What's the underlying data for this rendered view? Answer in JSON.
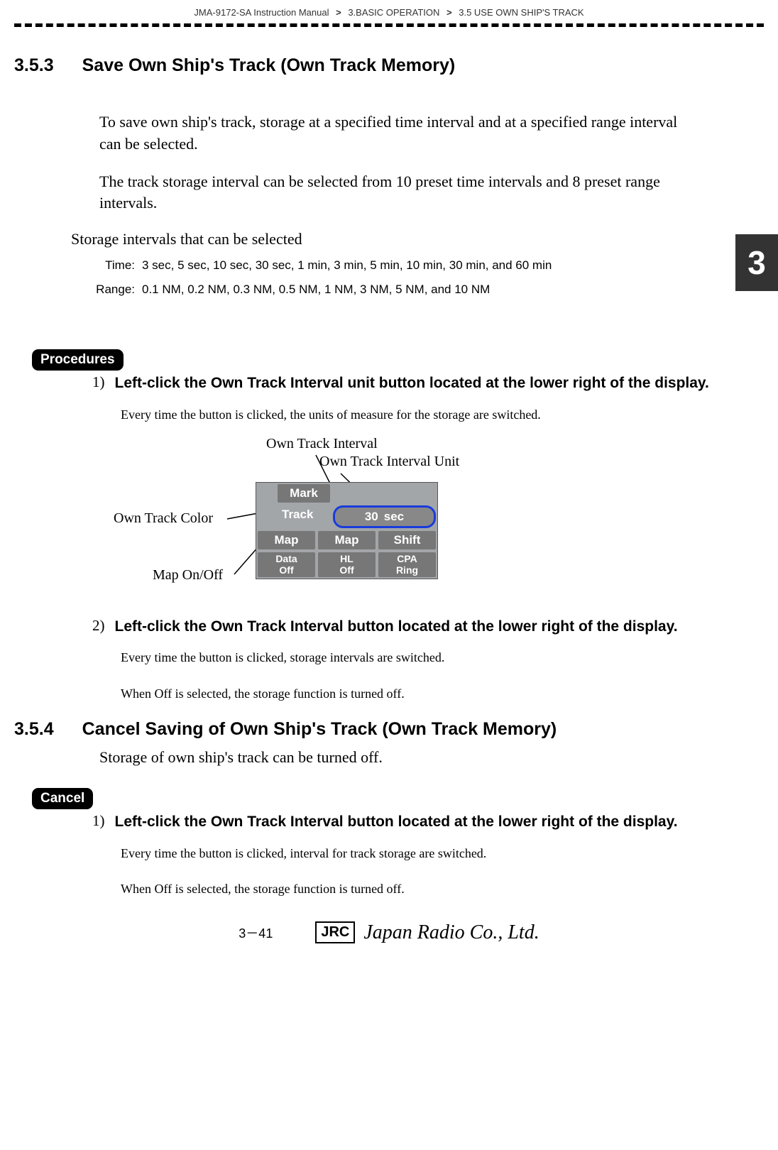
{
  "breadcrumb": {
    "manual": "JMA-9172-SA Instruction Manual",
    "chapter": "3.BASIC OPERATION",
    "section": "3.5  USE OWN SHIP'S TRACK",
    "sep": ">"
  },
  "chapter_tab": "3",
  "sec353": {
    "num": "3.5.3",
    "title": "Save Own Ship's Track (Own Track Memory)",
    "p1": "To save own ship's track, storage at a specified time interval and at a specified range interval can be selected.",
    "p2": "The track storage interval can be selected from 10 preset time intervals and 8 preset range intervals.",
    "subhead": "Storage intervals that can be selected",
    "time_label": "Time:",
    "time_values": "3 sec, 5 sec, 10 sec, 30 sec, 1 min, 3 min, 5 min, 10 min, 30 min, and 60 min",
    "range_label": "Range:",
    "range_values": "0.1 NM, 0.2 NM, 0.3 NM, 0.5 NM, 1 NM, 3 NM, 5 NM, and 10 NM"
  },
  "procedures_label": "Procedures",
  "proc1": {
    "num": "1)",
    "title": "Left-click the Own Track Interval unit button located at the lower right of the display.",
    "note": "Every time the button is clicked, the units of measure for the storage are switched."
  },
  "diagram": {
    "callout_interval": "Own Track Interval",
    "callout_interval_unit": "Own Track Interval Unit",
    "callout_color": "Own Track Color",
    "callout_map": "Map On/Off",
    "panel": {
      "mark": "Mark",
      "track": "Track",
      "interval_value": "30",
      "interval_unit": "sec",
      "map1": "Map",
      "map2": "Map",
      "shift": "Shift",
      "data_off_l1": "Data",
      "data_off_l2": "Off",
      "hl_off_l1": "HL",
      "hl_off_l2": "Off",
      "cpa_ring_l1": "CPA",
      "cpa_ring_l2": "Ring"
    }
  },
  "proc2": {
    "num": "2)",
    "title": "Left-click the Own Track Interval button located at the lower right of the display.",
    "note1": "Every time the button is clicked, storage intervals are switched.",
    "note2": "When  Off  is selected, the storage function is turned off."
  },
  "sec354": {
    "num": "3.5.4",
    "title": "Cancel Saving of Own Ship's Track (Own Track Memory)",
    "p1": "Storage of own ship's track can be turned off."
  },
  "cancel_label": "Cancel",
  "cancel1": {
    "num": "1)",
    "title": "Left-click the Own Track Interval button located at the lower right of the display.",
    "note1": "Every time the button is clicked, interval for track storage are switched.",
    "note2": "When  Off  is selected, the storage function is turned off."
  },
  "footer": {
    "page": "3－41",
    "jrc_box": "JRC",
    "jrc_script": "Japan Radio Co., Ltd."
  }
}
